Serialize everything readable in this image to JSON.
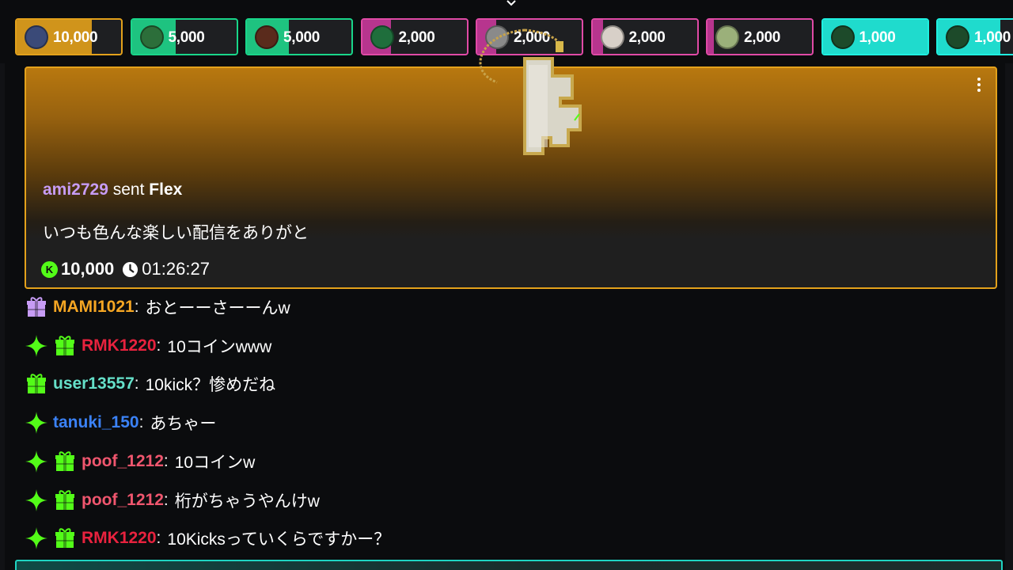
{
  "top_bar": {
    "pills": [
      {
        "amount": "10,000",
        "avatar_color": "#3a4a78",
        "border": "#e3a11b",
        "fill_color": "#e3a11b",
        "fill_fraction": 0.72
      },
      {
        "amount": "5,000",
        "avatar_color": "#2c6e3a",
        "border": "#19d68a",
        "fill_color": "#1ed58b",
        "fill_fraction": 0.42
      },
      {
        "amount": "5,000",
        "avatar_color": "#5a2b1c",
        "border": "#19d68a",
        "fill_color": "#1ed58b",
        "fill_fraction": 0.4
      },
      {
        "amount": "2,000",
        "avatar_color": "#1f6e3c",
        "border": "#e04aa6",
        "fill_color": "#c8379a",
        "fill_fraction": 0.28
      },
      {
        "amount": "2,000",
        "avatar_color": "#8a8a8a",
        "border": "#e04aa6",
        "fill_color": "#c8379a",
        "fill_fraction": 0.18
      },
      {
        "amount": "2,000",
        "avatar_color": "#d8d0c8",
        "border": "#e04aa6",
        "fill_color": "#c8379a",
        "fill_fraction": 0.1
      },
      {
        "amount": "2,000",
        "avatar_color": "#9bb07a",
        "border": "#e04aa6",
        "fill_color": "#c8379a",
        "fill_fraction": 0.06
      },
      {
        "amount": "1,000",
        "avatar_color": "#1d4a2a",
        "border": "#1ff0e0",
        "fill_color": "#1ff0e0",
        "fill_fraction": 1.0
      },
      {
        "amount": "1,000",
        "avatar_color": "#1d4a2a",
        "border": "#1ff0e0",
        "fill_color": "#1ff0e0",
        "fill_fraction": 0.6
      }
    ]
  },
  "gift_card": {
    "username": "ami2729",
    "sent_word": "sent",
    "gift_name": "Flex",
    "message": "いつも色んな楽しい配信をありがと",
    "coin_glyph": "K",
    "amount": "10,000",
    "time_left": "01:26:27",
    "accent": "#e3a11b"
  },
  "chat": [
    {
      "badges": [
        "gift-purple"
      ],
      "username": "MAMI1021",
      "color": "#f5a623",
      "text": "おとーーさーーんw"
    },
    {
      "badges": [
        "sparkle",
        "gift-green"
      ],
      "username": "RMK1220",
      "color": "#e8223e",
      "text": "10コインwww"
    },
    {
      "badges": [
        "gift-green"
      ],
      "username": "user13557",
      "color": "#65e0c9",
      "text": "10kick？惨めだね"
    },
    {
      "badges": [
        "sparkle"
      ],
      "username": "tanuki_150",
      "color": "#3b82f6",
      "text": "あちゃー"
    },
    {
      "badges": [
        "sparkle",
        "gift-green"
      ],
      "username": "poof_1212",
      "color": "#f0566e",
      "text": "10コインw"
    },
    {
      "badges": [
        "sparkle",
        "gift-green"
      ],
      "username": "poof_1212",
      "color": "#f0566e",
      "text": "桁がちゃうやんけw"
    },
    {
      "badges": [
        "sparkle",
        "gift-green"
      ],
      "username": "RMK1220",
      "color": "#e8223e",
      "text": "10Kicksっていくらですかー？"
    }
  ],
  "colors": {
    "kick_green": "#53fc18",
    "gift_purple": "#c79cf5",
    "bottom_accent": "#1fd4c2"
  }
}
